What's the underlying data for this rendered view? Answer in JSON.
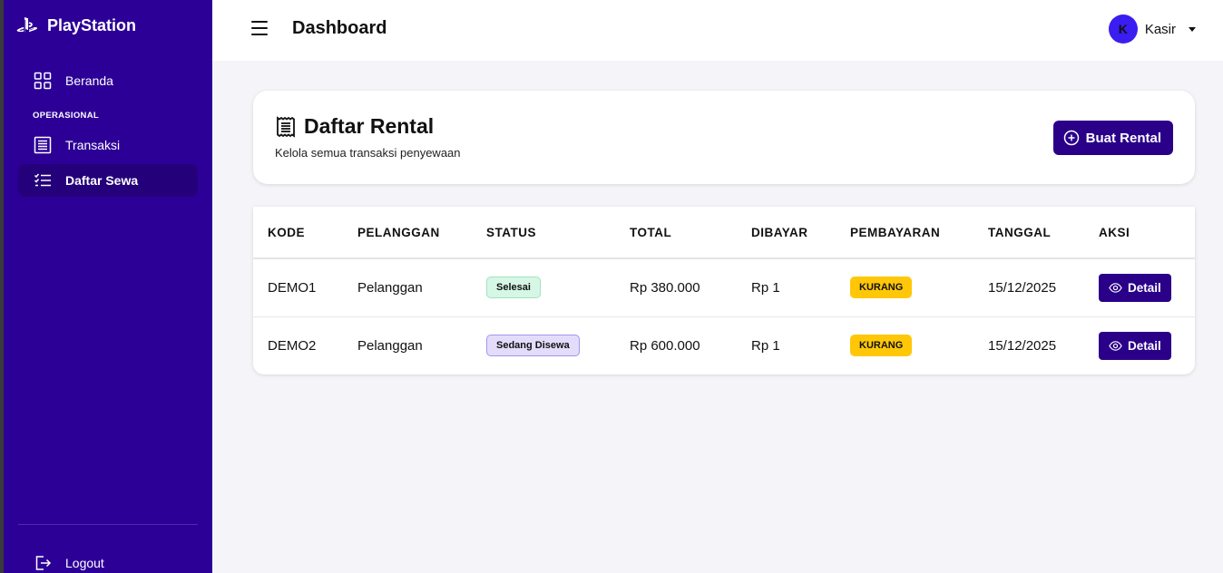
{
  "sidebar": {
    "brand": "PlayStation",
    "section_label": "OPERASIONAL",
    "items": [
      {
        "label": "Beranda",
        "icon": "grid-icon"
      },
      {
        "label": "Transaksi",
        "icon": "receipt-icon"
      },
      {
        "label": "Daftar Sewa",
        "icon": "list-icon"
      }
    ],
    "logout_label": "Logout"
  },
  "header": {
    "title": "Dashboard",
    "user_initial": "K",
    "user_name": "Kasir"
  },
  "card": {
    "title": "Daftar Rental",
    "subtitle": "Kelola semua transaksi penyewaan",
    "button_label": "Buat Rental"
  },
  "table": {
    "columns": [
      "KODE",
      "PELANGGAN",
      "STATUS",
      "TOTAL",
      "DIBAYAR",
      "PEMBAYARAN",
      "TANGGAL",
      "AKSI"
    ],
    "rows": [
      {
        "kode": "DEMO1",
        "pelanggan": "Pelanggan",
        "status": "Selesai",
        "total": "Rp 380.000",
        "dibayar": "Rp 1",
        "pembayaran": "KURANG",
        "tanggal": "15/12/2025",
        "aksi": "Detail"
      },
      {
        "kode": "DEMO2",
        "pelanggan": "Pelanggan",
        "status": "Sedang Disewa",
        "total": "Rp 600.000",
        "dibayar": "Rp 1",
        "pembayaran": "KURANG",
        "tanggal": "15/12/2025",
        "aksi": "Detail"
      }
    ]
  },
  "colors": {
    "sidebar_bg": "#2c0097",
    "primary": "#2a0089",
    "avatar": "#3a1df0",
    "status_done_bg": "#d6f7e6",
    "status_rent_bg": "#e4dcfb",
    "payment_badge": "#ffc708"
  }
}
